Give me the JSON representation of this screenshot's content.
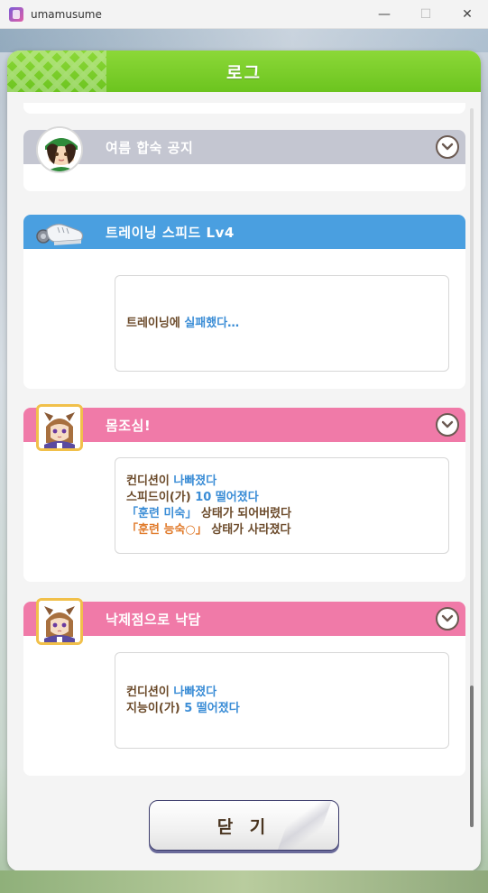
{
  "window": {
    "app_title": "umamusume",
    "min_glyph": "—",
    "max_glyph": "☐",
    "close_glyph": "✕"
  },
  "dialog": {
    "title": "로그",
    "close_label": "닫 기"
  },
  "log": [
    {
      "title": "여름 합숙 공지",
      "style": "gray",
      "icon": "trainer-portrait"
    },
    {
      "title": "트레이닝 스피드 Lv4",
      "style": "blue",
      "icon": "shoe-icon",
      "lines": [
        {
          "parts": [
            "트레이닝에 ",
            "실패했다…"
          ]
        }
      ]
    },
    {
      "title": "몸조심!",
      "style": "pink",
      "icon": "horse-girl-portrait",
      "lines": [
        {
          "parts": [
            "컨디션이 ",
            "나빠졌다"
          ]
        },
        {
          "parts": [
            "스피드이(가) ",
            "10 떨어졌다"
          ]
        },
        {
          "parts": [
            "「훈련 미숙」",
            " 상태가 되어버렸다"
          ]
        },
        {
          "parts": [
            "「훈련 능숙○」",
            " 상태가 사라졌다"
          ]
        }
      ]
    },
    {
      "title": "낙제점으로 낙담",
      "style": "pink",
      "icon": "horse-girl-portrait",
      "lines": [
        {
          "parts": [
            "컨디션이 ",
            "나빠졌다"
          ]
        },
        {
          "parts": [
            "지능이(가) ",
            "5 떨어졌다"
          ]
        }
      ]
    }
  ],
  "colors": {
    "header_green": "#6cc41f",
    "gray": "#c4c6d1",
    "blue": "#4a9fe0",
    "pink": "#f07aa8",
    "text_brown": "#6b4a2a",
    "text_blue": "#3b8dd6",
    "text_orange": "#e07a2a"
  }
}
